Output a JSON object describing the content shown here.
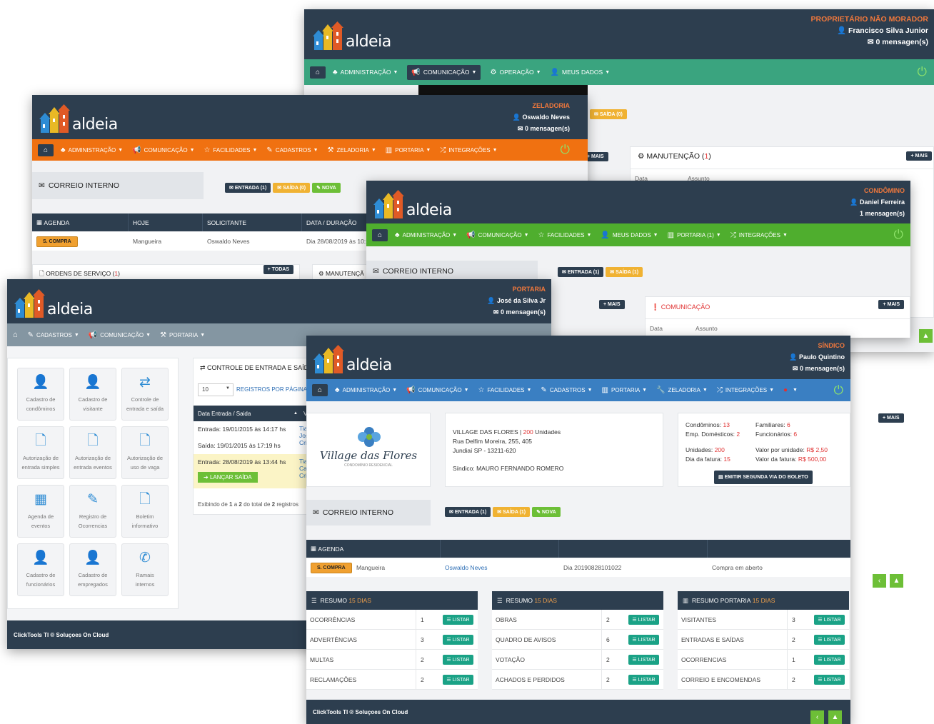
{
  "brand": {
    "logo_text": "aldeia",
    "footer": "ClickTools TI ® Soluçoes On Cloud"
  },
  "w1": {
    "role": "PROPRIETÁRIO NÃO MORADOR",
    "user": "Francisco Silva Junior",
    "messages": "0 mensagen(s)",
    "menu": [
      "ADMINISTRAÇÃO",
      "COMUNICAÇÃO",
      "OPERAÇÃO",
      "MEUS DADOS"
    ],
    "saida_btn": "SAÍDA (0)",
    "mais": "MAIS",
    "manutencao_title": "MANUTENÇÃO",
    "manutencao_count": "1",
    "col_data": "Data",
    "col_assunto": "Assunto"
  },
  "w2": {
    "role": "ZELADORIA",
    "user": "Oswaldo Neves",
    "messages": "0 mensagen(s)",
    "menu": [
      "ADMINISTRAÇÃO",
      "COMUNICAÇÃO",
      "FACILIDADES",
      "CADASTROS",
      "ZELADORIA",
      "PORTARIA",
      "INTEGRAÇÕES"
    ],
    "correio": "CORREIO INTERNO",
    "btn_entrada": "ENTRADA (1)",
    "btn_saida": "SAÍDA (0)",
    "btn_nova": "NOVA",
    "agenda_headers": [
      "AGENDA",
      "HOJE",
      "SOLICITANTE",
      "DATA / DURAÇÃO"
    ],
    "row": {
      "badge": "S. COMPRA",
      "hoje": "Mangueira",
      "solicitante": "Oswaldo Neves",
      "data": "Dia 28/08/2019 às 10:1"
    },
    "ordens": "ORDENS DE SERVIÇO",
    "ordens_count": "1",
    "todas": "TODAS",
    "manutenc": "MANUTENÇÃ",
    "mais": "MAIS"
  },
  "w3": {
    "role": "CONDÔMINO",
    "user": "Daniel Ferreira",
    "messages": "1 mensagen(s)",
    "menu": [
      "ADMINISTRAÇÃO",
      "COMUNICAÇÃO",
      "FACILIDADES",
      "MEUS DADOS",
      "PORTARIA (1)",
      "INTEGRAÇÕES"
    ],
    "correio": "CORREIO INTERNO",
    "btn_entrada": "ENTRADA (1)",
    "btn_saida": "SAÍDA (1)",
    "mais": "MAIS",
    "comunicacao": "COMUNICAÇÃO",
    "col_data": "Data",
    "col_assunto": "Assunto"
  },
  "w4": {
    "role": "PORTARIA",
    "user": "José da Silva Jr",
    "messages": "0 mensagen(s)",
    "menu": [
      "CADASTROS",
      "COMUNICAÇÃO",
      "PORTARIA"
    ],
    "tiles": [
      {
        "icon": "user-icon",
        "glyph": "👤",
        "line1": "Cadastro de",
        "line2": "condôminos"
      },
      {
        "icon": "user-icon",
        "glyph": "👤",
        "line1": "Cadastro de",
        "line2": "visitante"
      },
      {
        "icon": "exchange-icon",
        "glyph": "⇄",
        "line1": "Controle de",
        "line2": "entrada e saída"
      },
      {
        "icon": "document-icon",
        "glyph": "🗋",
        "line1": "Autorização de",
        "line2": "entrada simples"
      },
      {
        "icon": "document-icon",
        "glyph": "🗋",
        "line1": "Autorização de",
        "line2": "entrada eventos"
      },
      {
        "icon": "document-icon",
        "glyph": "🗋",
        "line1": "Autorização de",
        "line2": "uso de vaga"
      },
      {
        "icon": "calendar-icon",
        "glyph": "▦",
        "line1": "Agenda de",
        "line2": "eventos"
      },
      {
        "icon": "edit-icon",
        "glyph": "✎",
        "line1": "Registro de",
        "line2": "Ocorrencias"
      },
      {
        "icon": "document-icon",
        "glyph": "🗋",
        "line1": "Boletim",
        "line2": "informativo"
      },
      {
        "icon": "user-icon",
        "glyph": "👤",
        "line1": "Cadastro de",
        "line2": "funcionários"
      },
      {
        "icon": "user-icon",
        "glyph": "👤",
        "line1": "Cadastro de",
        "line2": "empregados"
      },
      {
        "icon": "phone-icon",
        "glyph": "✆",
        "line1": "Ramais",
        "line2": "internos"
      }
    ],
    "controle_title": "CONTROLE DE ENTRADA E SAÍDA",
    "page_size": "10",
    "registros": "REGISTROS POR PÁGINA",
    "col_data": "Data Entrada / Saida",
    "col_vi": "Vi",
    "rows": [
      "Entrada: 19/01/2015 às 14:17 hs",
      "Saída: 19/01/2015 às 17:19 hs",
      "Entrada: 28/08/2019 às 13:44 hs"
    ],
    "side": [
      "Tia",
      "Jos",
      "Cri",
      "Tia",
      "Cal",
      "Cri"
    ],
    "lancar": "LANÇAR SAÍDA",
    "exibindo_pre": "Exibindo de ",
    "exibindo_a": "1",
    "exibindo_mid": " a ",
    "exibindo_b": "2",
    "exibindo_mid2": " do total de ",
    "exibindo_c": "2",
    "exibindo_post": " registros"
  },
  "w5": {
    "role": "SÍNDICO",
    "user": "Paulo Quintino",
    "messages": "0 mensagen(s)",
    "menu": [
      "ADMINISTRAÇÃO",
      "COMUNICAÇÃO",
      "FACILIDADES",
      "CADASTROS",
      "PORTARIA",
      "ZELADORIA",
      "INTEGRAÇÕES"
    ],
    "condo_logo_text": "Village das Flores",
    "condo_logo_sub": "CONDOMÍNIO RESIDENCIAL",
    "condo_name": "VILLAGE DAS FLORES",
    "condo_units": "200",
    "condo_units_label": "Unidades",
    "address1": "Rua Delfim Moreira, 255, 405",
    "address2": "Jundiaí SP - 13211-620",
    "sindico": "Síndico: MAURO FERNANDO ROMERO",
    "stats": [
      {
        "label": "Condôminos:",
        "value": "13"
      },
      {
        "label": "Familiares:",
        "value": "6"
      },
      {
        "label": "Emp. Domésticos:",
        "value": "2"
      },
      {
        "label": "Funcionários:",
        "value": "6"
      },
      {
        "label": "Unidades:",
        "value": "200"
      },
      {
        "label": "Valor por unidade:",
        "value": "R$ 2,50"
      },
      {
        "label": "Dia da fatura:",
        "value": "15"
      },
      {
        "label": "Valor da fatura:",
        "value": "R$ 500,00"
      }
    ],
    "boleto": "EMITIR SEGUNDA VIA DO BOLETO",
    "mais": "MAIS",
    "correio": "CORREIO INTERNO",
    "btn_entrada": "ENTRADA (1)",
    "btn_saida": "SAÍDA (1)",
    "btn_nova": "NOVA",
    "agenda": "AGENDA",
    "agenda_row": {
      "badge": "S. COMPRA",
      "hoje": "Mangueira",
      "solicitante": "Oswaldo Neves",
      "data": "Dia 20190828101022",
      "status": "Compra em aberto"
    },
    "resumos": [
      {
        "title": "RESUMO",
        "days": "15 DIAS",
        "rows": [
          [
            "OCORRÊNCIAS",
            "1"
          ],
          [
            "ADVERTÊNCIAS",
            "3"
          ],
          [
            "MULTAS",
            "2"
          ],
          [
            "RECLAMAÇÕES",
            "2"
          ]
        ]
      },
      {
        "title": "RESUMO",
        "days": "15 DIAS",
        "rows": [
          [
            "OBRAS",
            "2"
          ],
          [
            "QUADRO DE AVISOS",
            "6"
          ],
          [
            "VOTAÇÃO",
            "2"
          ],
          [
            "ACHADOS E PERDIDOS",
            "2"
          ]
        ]
      },
      {
        "title": "RESUMO PORTARIA",
        "days": "15 DIAS",
        "rows": [
          [
            "VISITANTES",
            "3"
          ],
          [
            "ENTRADAS E SAÍDAS",
            "2"
          ],
          [
            "OCORRENCIAS",
            "1"
          ],
          [
            "CORREIO E ENCOMENDAS",
            "2"
          ]
        ]
      }
    ],
    "listar": "LISTAR"
  },
  "colors": {
    "dark": "#2d3e4f",
    "teal": "#3aa47f",
    "orange": "#f07111",
    "green": "#4fae2e",
    "gray": "#8496a2",
    "blue": "#3a7fc2"
  }
}
